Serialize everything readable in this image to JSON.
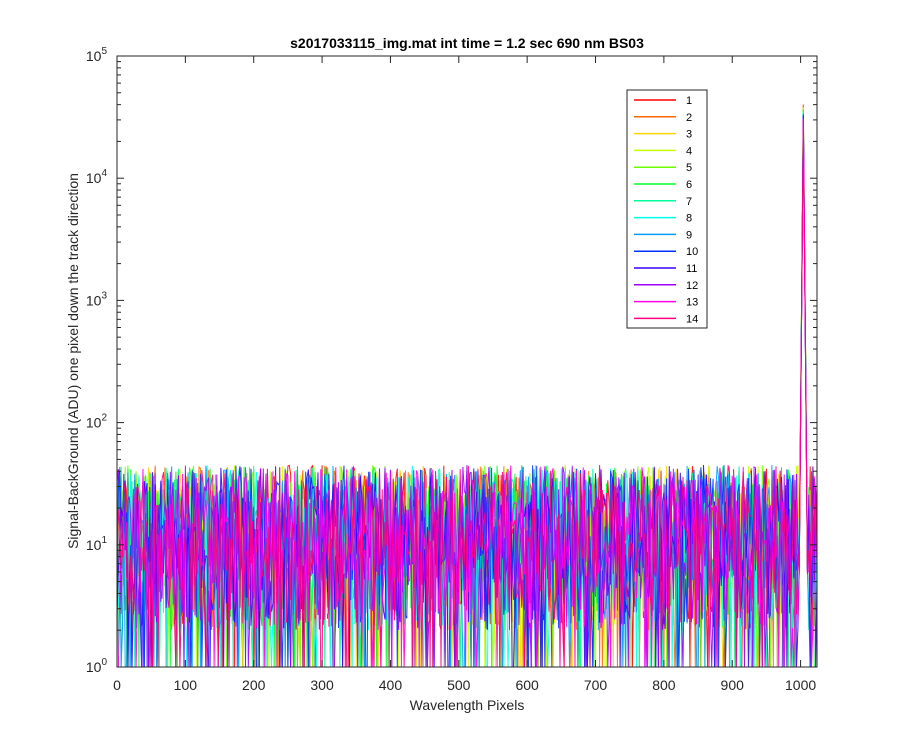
{
  "chart_data": {
    "type": "line",
    "title": "s2017033115_img.mat int time = 1.2 sec  690 nm BS03",
    "xlabel": "Wavelength Pixels",
    "ylabel": "Signal-BackGround (ADU) one pixel down the track direction",
    "xlim": [
      0,
      1024
    ],
    "ylim": [
      1,
      100000
    ],
    "yscale": "log",
    "x_ticks": [
      "0",
      "100",
      "200",
      "300",
      "400",
      "500",
      "600",
      "700",
      "800",
      "900",
      "1000"
    ],
    "y_ticks": [
      {
        "base": "10",
        "exp": "0"
      },
      {
        "base": "10",
        "exp": "1"
      },
      {
        "base": "10",
        "exp": "2"
      },
      {
        "base": "10",
        "exp": "3"
      },
      {
        "base": "10",
        "exp": "4"
      },
      {
        "base": "10",
        "exp": "5"
      }
    ],
    "legend_position": "top-right",
    "grid": false,
    "noise_floor_range": [
      1,
      50
    ],
    "peak": {
      "x": 1004,
      "y_max": 40000,
      "y_min": 30000
    },
    "series": [
      {
        "name": "1",
        "color": "#ff0000"
      },
      {
        "name": "2",
        "color": "#ff6a00"
      },
      {
        "name": "3",
        "color": "#ffd400"
      },
      {
        "name": "4",
        "color": "#c8ff00"
      },
      {
        "name": "5",
        "color": "#6aff00"
      },
      {
        "name": "6",
        "color": "#00ff2a"
      },
      {
        "name": "7",
        "color": "#00ff9c"
      },
      {
        "name": "8",
        "color": "#00ffee"
      },
      {
        "name": "9",
        "color": "#009cff"
      },
      {
        "name": "10",
        "color": "#0033ff"
      },
      {
        "name": "11",
        "color": "#3a00ff"
      },
      {
        "name": "12",
        "color": "#a000ff"
      },
      {
        "name": "13",
        "color": "#ff00ee"
      },
      {
        "name": "14",
        "color": "#ff0080"
      }
    ]
  }
}
